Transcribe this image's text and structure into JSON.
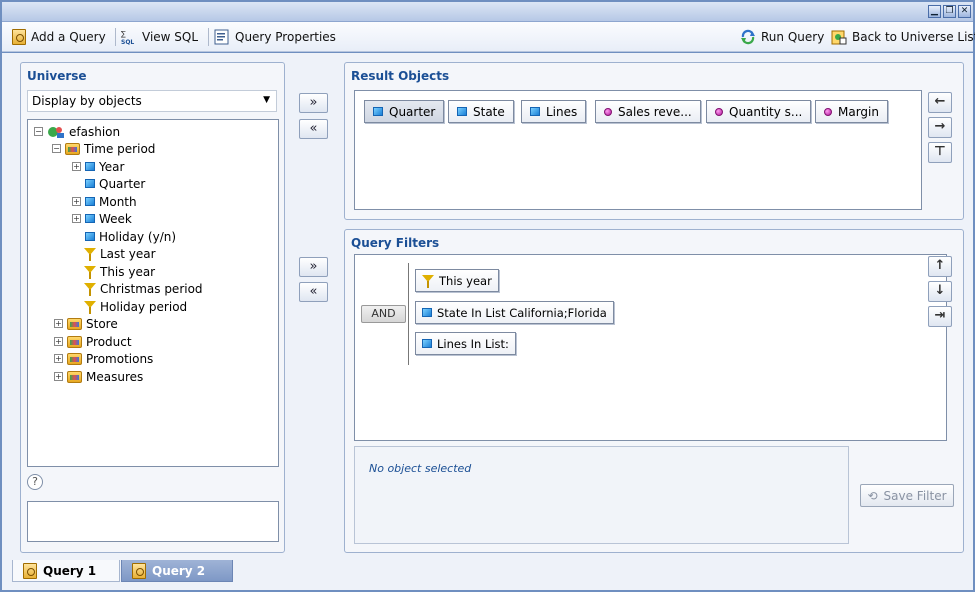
{
  "toolbar": {
    "add_query": "Add a Query",
    "view_sql": "View SQL",
    "query_properties": "Query Properties",
    "run_query": "Run Query",
    "back_to_universe": "Back to Universe List"
  },
  "universe": {
    "title": "Universe",
    "display_mode": "Display by objects",
    "tree": {
      "root": "efashion",
      "time_period": "Time period",
      "year": "Year",
      "quarter": "Quarter",
      "month": "Month",
      "week": "Week",
      "holiday_yn": "Holiday (y/n)",
      "last_year": "Last year",
      "this_year": "This year",
      "christmas_period": "Christmas period",
      "holiday_period": "Holiday period",
      "store": "Store",
      "product": "Product",
      "promotions": "Promotions",
      "measures": "Measures"
    },
    "help_symbol": "?"
  },
  "transfer": {
    "add_label": "»",
    "remove_label": "«"
  },
  "result_objects": {
    "title": "Result Objects",
    "items": [
      "Quarter",
      "State",
      "Lines",
      "Sales reve...",
      "Quantity s...",
      "Margin"
    ]
  },
  "query_filters": {
    "title": "Query Filters",
    "operator": "AND",
    "filters": [
      "This year",
      "State In List California;Florida",
      "Lines In List:"
    ],
    "status": "No object selected",
    "save_filter": "Save Filter"
  },
  "tabs": [
    "Query 1",
    "Query 2"
  ],
  "colors": {
    "title_blue": "#1b4f95",
    "tab_active_bg": "#f7f9fc",
    "tab_inactive_bg": "#8aa2cc"
  }
}
